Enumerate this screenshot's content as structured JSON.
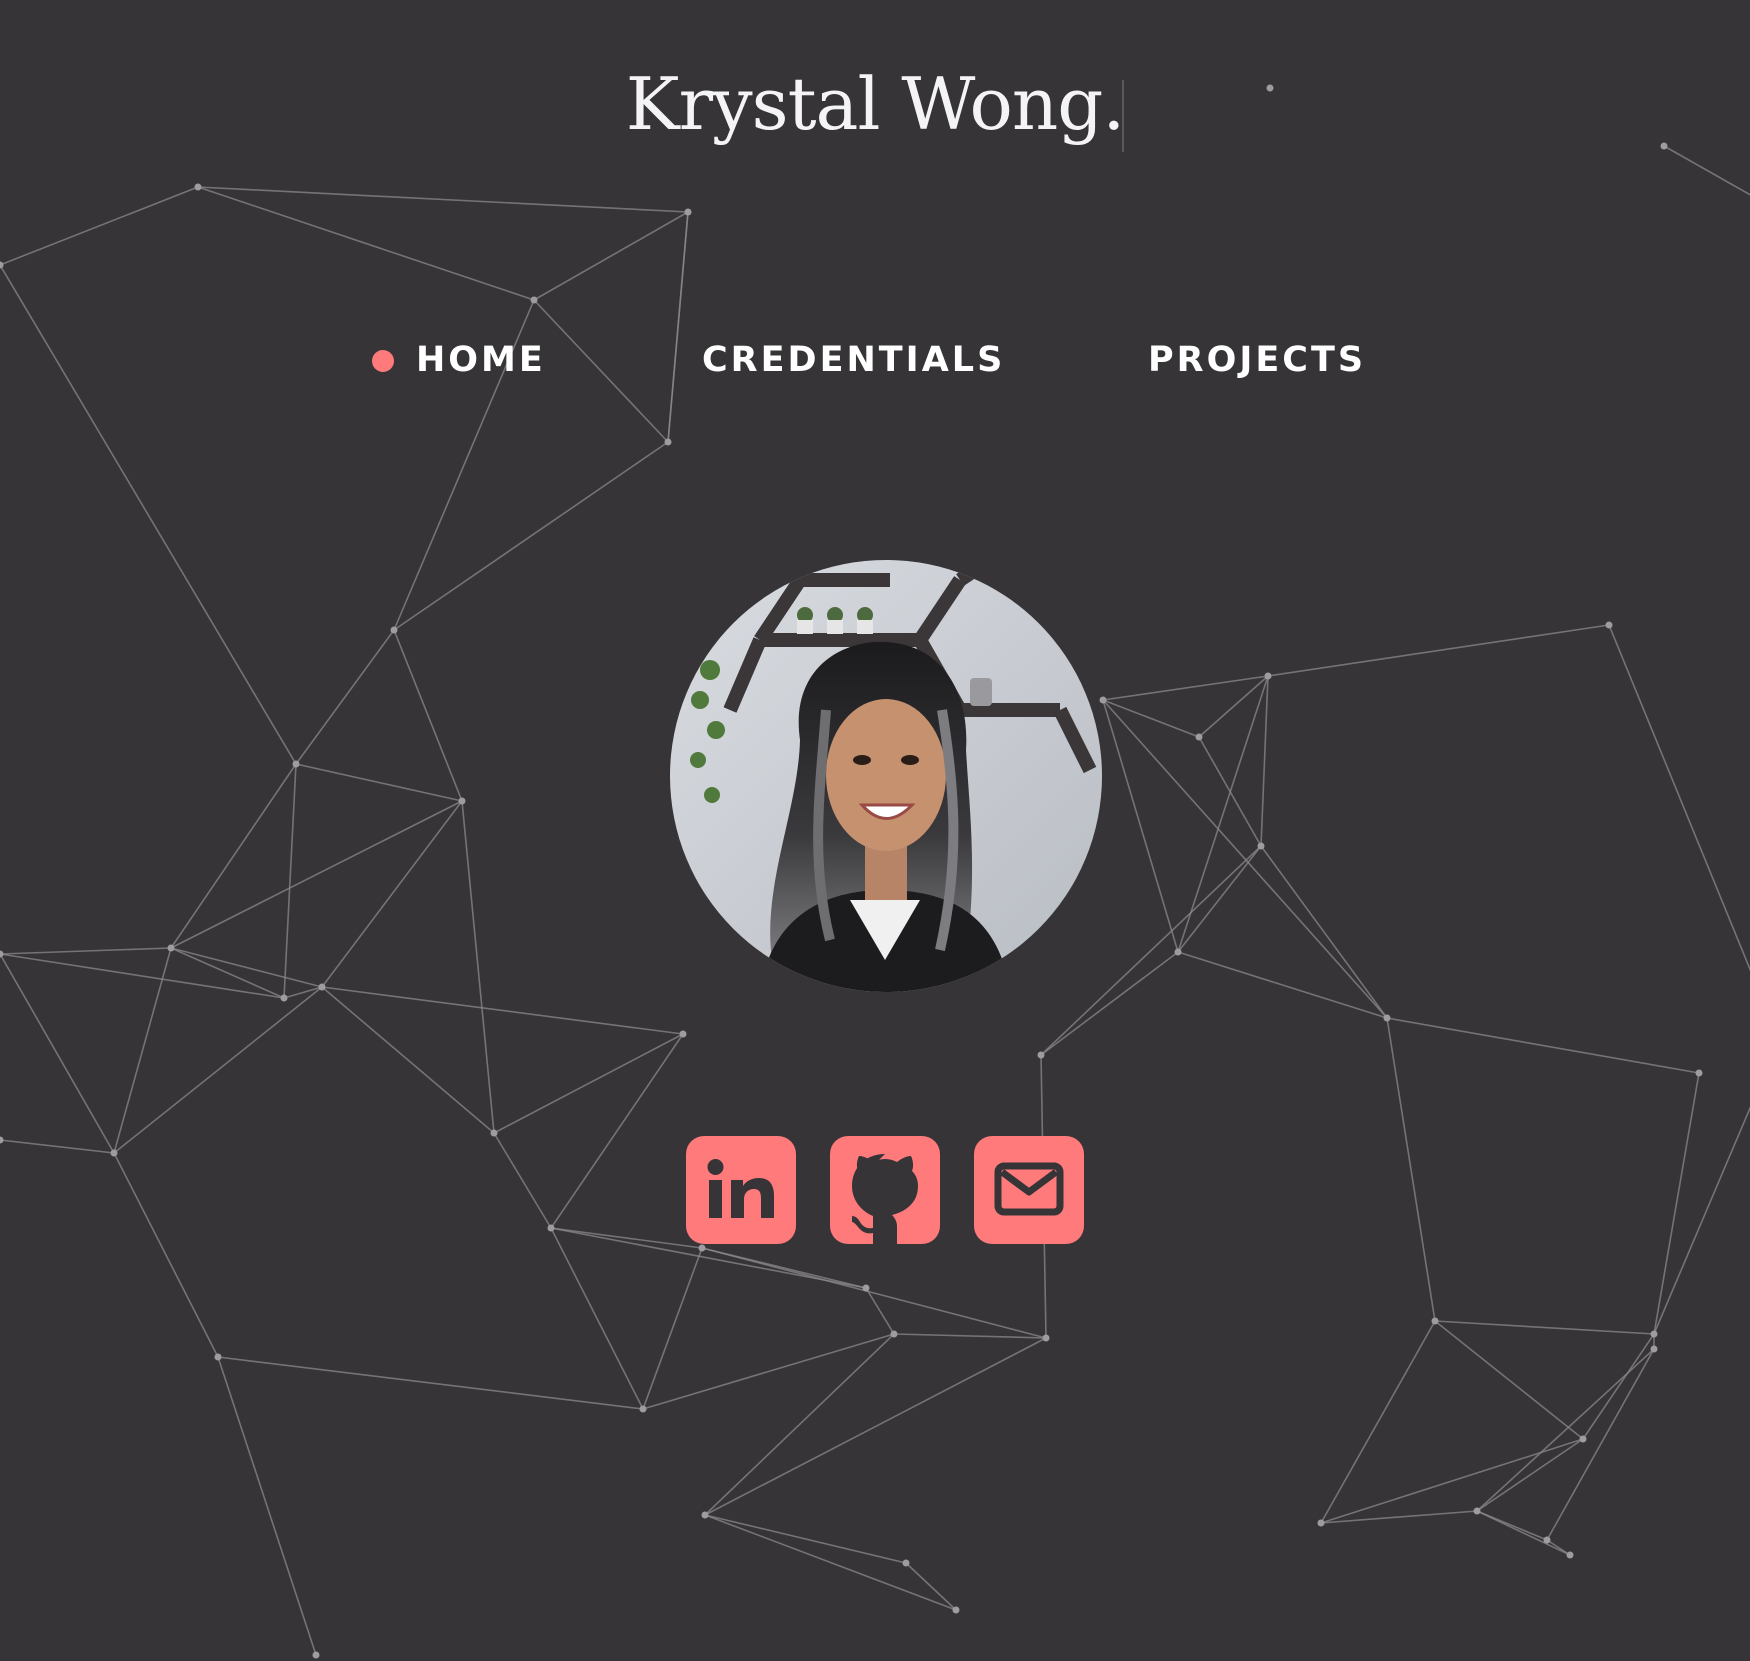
{
  "header": {
    "title": "Krystal Wong."
  },
  "nav": {
    "items": [
      {
        "label": "HOME",
        "active": true
      },
      {
        "label": "CREDENTIALS",
        "active": false
      },
      {
        "label": "PROJECTS",
        "active": false
      }
    ]
  },
  "profile": {
    "photo_icon": "profile-photo"
  },
  "socials": [
    {
      "icon": "linkedin-icon"
    },
    {
      "icon": "github-icon"
    },
    {
      "icon": "email-icon"
    }
  ],
  "colors": {
    "background": "#363437",
    "accent": "#ff7a7b",
    "text": "#ffffff",
    "network_lines": "#8a888c"
  }
}
